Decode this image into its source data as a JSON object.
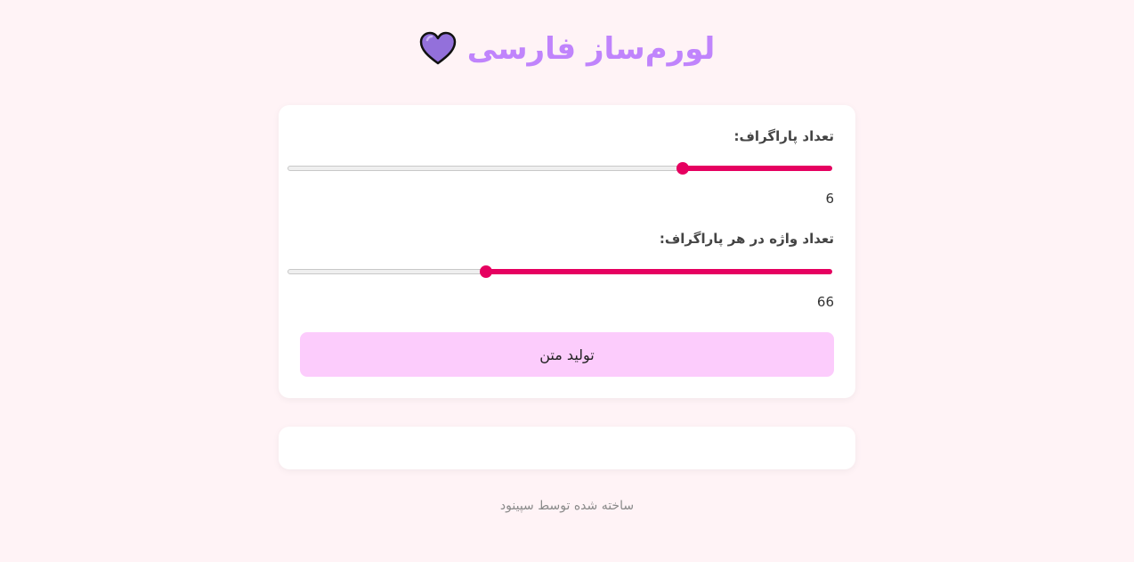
{
  "header": {
    "title": "لورم‌ساز فارسی",
    "icon": "heart-icon",
    "icon_color": "#9370db",
    "title_color": "#c084fc"
  },
  "controls": {
    "paragraph_count": {
      "label": "تعداد پاراگراف:",
      "value": "6",
      "fill_fraction": 0.275
    },
    "words_per_paragraph": {
      "label": "تعداد واژه در هر پاراگراف:",
      "value": "66",
      "fill_fraction": 0.635
    },
    "generate_label": "تولید متن",
    "accent_color": "#e60060"
  },
  "output": {
    "text": ""
  },
  "footer": {
    "credit": "ساخته شده توسط سپینود"
  }
}
